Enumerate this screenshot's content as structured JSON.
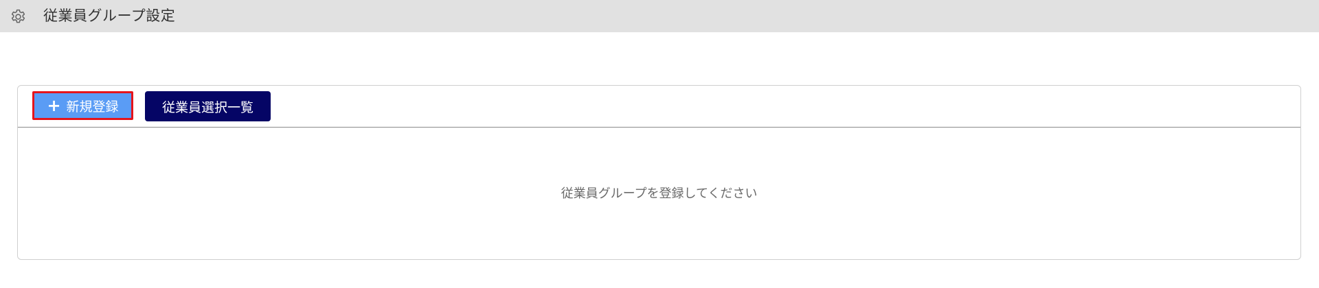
{
  "header": {
    "icon": "gear-icon",
    "title": "従業員グループ設定",
    "background": "#e1e1e1"
  },
  "toolbar": {
    "new_button": {
      "icon": "plus-icon",
      "icon_glyph": "+",
      "label": "新規登録",
      "color": "#5a9cf5",
      "highlight_border": "#e5141b"
    },
    "list_button": {
      "label": "従業員選択一覧",
      "color": "#050565"
    }
  },
  "panel": {
    "empty_message": "従業員グループを登録してください"
  }
}
